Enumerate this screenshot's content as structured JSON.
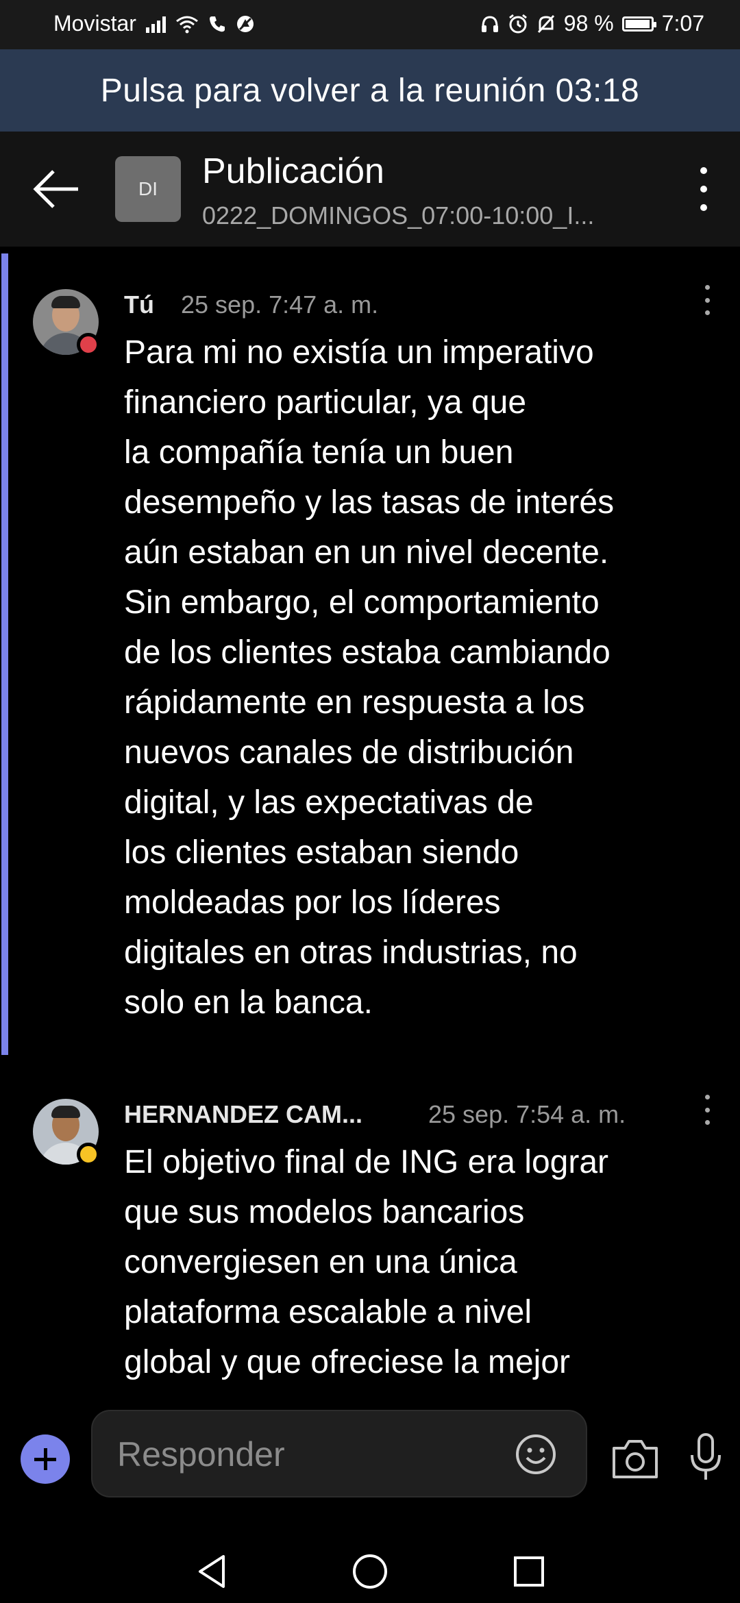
{
  "status_bar": {
    "carrier": "Movistar",
    "battery": "98 %",
    "battery_level": 0.98,
    "time": "7:07",
    "icons": [
      "signal-icon",
      "wifi-icon",
      "call-icon",
      "vpn-icon",
      "headphones-icon",
      "alarm-icon",
      "mute-icon",
      "battery-icon"
    ]
  },
  "banner": {
    "text": "Pulsa para volver a la reunión 03:18"
  },
  "header": {
    "avatar_initials": "DI",
    "title": "Publicación",
    "subtitle": "0222_DOMINGOS_07:00-10:00_I..."
  },
  "messages": [
    {
      "author": "Tú",
      "time": "25 sep. 7:47 a. m.",
      "presence_color": "#e0404a",
      "body": "Para mi no existía un imperativo\nfinanciero particular, ya que\nla compañía tenía un buen\ndesempeño y las tasas de interés\naún estaban en un nivel decente.\nSin embargo, el comportamiento\nde los clientes estaba cambiando\nrápidamente en respuesta a los\nnuevos canales de distribución\ndigital, y las expectativas de\nlos clientes estaban siendo\nmoldeadas por los líderes\ndigitales en otras industrias, no\nsolo en la banca."
    },
    {
      "author": "HERNANDEZ CAM...",
      "time": "25 sep. 7:54 a. m.",
      "presence_color": "#f7c325",
      "body": "El objetivo final de ING era lograr\nque sus modelos bancarios\nconvergiesen en una única\nplataforma escalable a nivel\nglobal y que ofreciese la mejor"
    }
  ],
  "compose": {
    "placeholder": "Responder"
  },
  "colors": {
    "accent": "#7b83eb",
    "banner_bg": "#2b3a52",
    "header_bg": "#141414"
  }
}
